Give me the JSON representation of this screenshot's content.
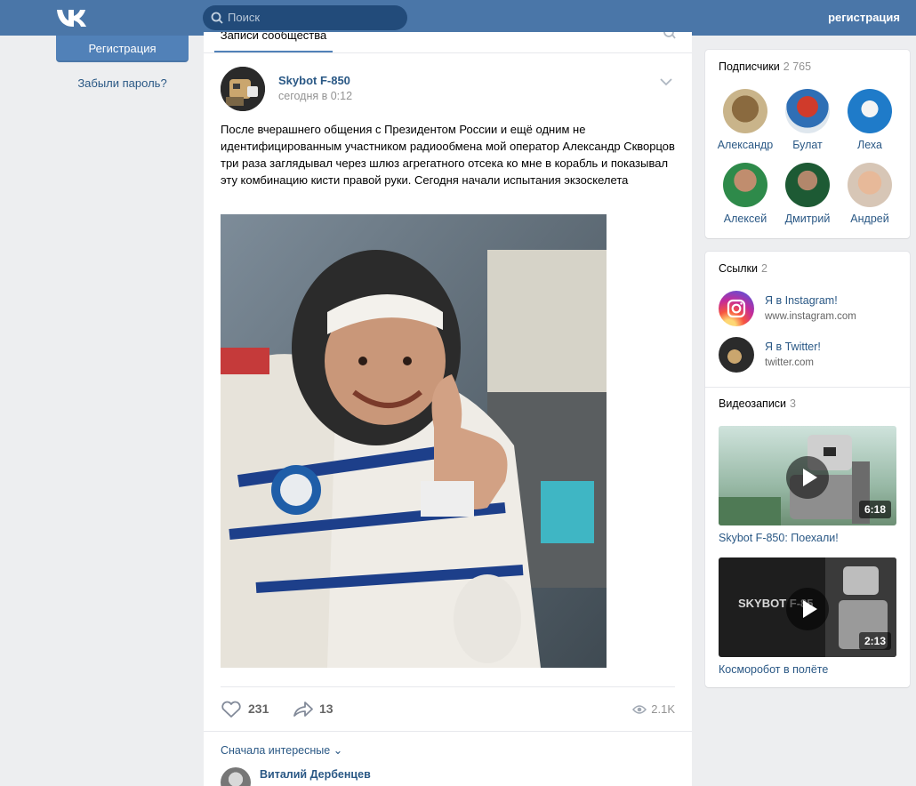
{
  "header": {
    "search_placeholder": "Поиск",
    "register_link": "регистрация"
  },
  "left": {
    "register_button": "Регистрация",
    "forgot_password": "Забыли пароль?"
  },
  "tabs": {
    "active_label": "Записи сообщества"
  },
  "post": {
    "author": "Skybot F-850",
    "date": "сегодня в 0:12",
    "text": "После вчерашнего общения с Президентом России и ещё одним не идентифицированным участником радиообмена мой оператор Александр Скворцов три раза заглядывал через шлюз агрегатного отсека ко мне в корабль и показывал эту комбинацию кисти правой руки. Сегодня начали испытания экзоскелета",
    "likes": "231",
    "shares": "13",
    "views": "2.1K",
    "sort_label": "Сначала интересные",
    "commenter": "Виталий Дербенцев"
  },
  "subscribers": {
    "title": "Подписчики",
    "count": "2 765",
    "people": [
      {
        "name": "Александр"
      },
      {
        "name": "Булат"
      },
      {
        "name": "Леха"
      },
      {
        "name": "Алексей"
      },
      {
        "name": "Дмитрий"
      },
      {
        "name": "Андрей"
      }
    ]
  },
  "links": {
    "title": "Ссылки",
    "count": "2",
    "items": [
      {
        "name": "Я в Instagram!",
        "url": "www.instagram.com",
        "icon": "instagram-icon"
      },
      {
        "name": "Я в Twitter!",
        "url": "twitter.com",
        "icon": "robot-avatar"
      }
    ]
  },
  "videos": {
    "title": "Видеозаписи",
    "count": "3",
    "items": [
      {
        "title": "Skybot F-850: Поехали!",
        "duration": "6:18"
      },
      {
        "title": "Косморобот в полёте",
        "duration": "2:13"
      }
    ]
  },
  "colors": {
    "header": "#4a76a8",
    "link": "#2a5885",
    "background": "#edeef0"
  }
}
